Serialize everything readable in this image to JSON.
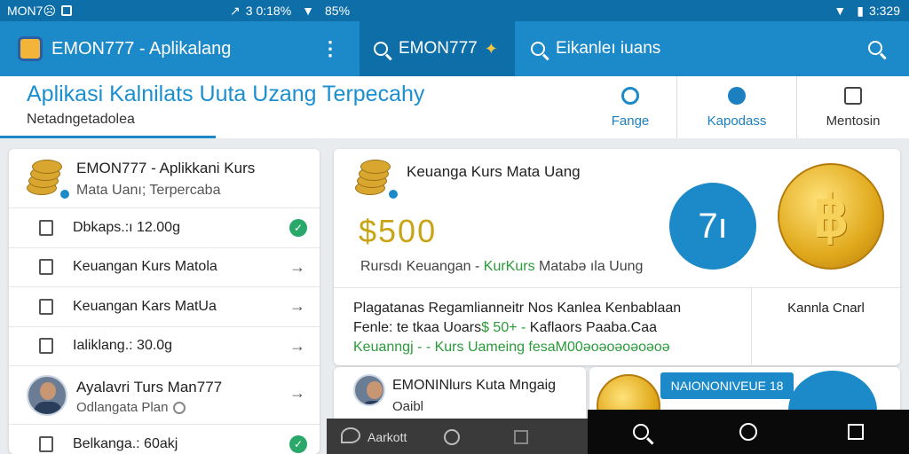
{
  "status_bar": {
    "left_app": "MON7☹",
    "left_metrics": "3 0:18%",
    "left_signal": "85%",
    "right_time": "3:329"
  },
  "app_bar": {
    "title": "EMON777 - Aplikalang",
    "search_tab_text": "EMON777",
    "search_placeholder": "Eikanleı iuans"
  },
  "header": {
    "title": "Aplikasi Kalnilats Uuta Uzang Terpecahy",
    "subtitle": "Netadngetadolea",
    "buttons": [
      {
        "label": "Fange",
        "icon": "range-icon"
      },
      {
        "label": "Kapodass",
        "icon": "deposit-icon"
      },
      {
        "label": "Mentosin",
        "icon": "home-icon"
      }
    ]
  },
  "left_panel": {
    "title": "EMON777 - Aplikkani Kurs",
    "subtitle": "Mata Uanı; Terpercaba",
    "rows": [
      {
        "label": "Dbkaps.:ı 12.00g",
        "icon": "document-icon",
        "action": "check"
      },
      {
        "label": "Keuangan Kurs Matola",
        "icon": "edit-icon",
        "action": "arrow"
      },
      {
        "label": "Keuangan Kars MatUa",
        "icon": "chat-icon",
        "action": "arrow"
      },
      {
        "label": "Ialiklang.: 30.0g",
        "icon": "document-icon",
        "action": "arrow"
      }
    ],
    "profile": {
      "name": "Ayalavri Turs Man777",
      "sub": "Odlangata Plan"
    },
    "last_row": {
      "label": "Belkanga.: 60akj",
      "icon": "folder-icon",
      "action": "check"
    }
  },
  "main_card": {
    "title": "Keuanga Kurs Mata Uang",
    "amount": "$500",
    "desc_prefix": "Rursdı Keuangan -",
    "desc_green": "KurKurs",
    "desc_suffix": "Matabə ıla Uung",
    "badge_text": "7ı",
    "coin_symbol": "฿",
    "footer_line1": "Plagatanas Regamlianneitr Nos Kanlea Kenbablaan",
    "footer_line2_a": "Fenle: te tkaa Uoars",
    "footer_line2_b": "$ 50+ -",
    "footer_line2_c": "Kaflaors Paaba.Caa",
    "footer_line3": "Keuanngj - - Kurs Uameing fesaM00əoəoəoəoəoə",
    "footer_right": "Kannla Cnarl"
  },
  "bottom_cards": {
    "left_title": "EMONINlurs Kuta Mngaig",
    "left_sub": "Oaibl",
    "right_pill": "NAIONONIVEUE 18"
  },
  "nav": {
    "left_label": "Aarkott"
  },
  "colors": {
    "primary": "#1c8ac8",
    "primary_dark": "#0d6ea8",
    "accent_gold": "#c9a516",
    "success": "#2aa86a"
  }
}
